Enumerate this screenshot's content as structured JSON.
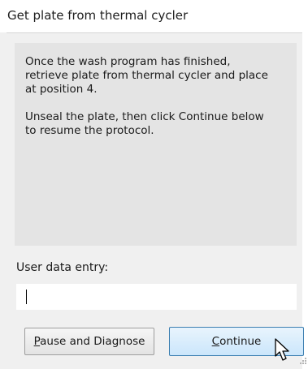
{
  "dialog": {
    "title": "Get plate from thermal cycler",
    "message": "Once the wash program has finished,\nretrieve plate from thermal cycler and place\nat position 4.\n\nUnseal the plate, then click Continue below\nto resume the protocol.",
    "entry_label": "User data entry:",
    "entry_value": "",
    "buttons": {
      "pause": {
        "mnemonic": "P",
        "rest": "ause and Diagnose"
      },
      "continue": {
        "mnemonic": "C",
        "rest": "ontinue"
      }
    }
  },
  "icons": {
    "cursor": "mouse-pointer-icon",
    "resize": "resize-grip-icon"
  },
  "colors": {
    "background": "#f0f0f0",
    "message_panel": "#e4e4e4",
    "continue_border": "#3c7fb1",
    "continue_fill": "#cbe6fb"
  }
}
